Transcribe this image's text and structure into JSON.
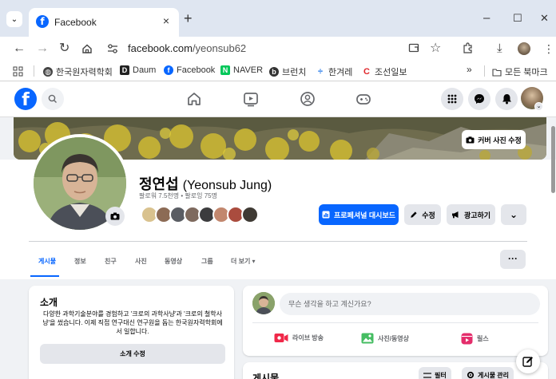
{
  "browser": {
    "tab_title": "Facebook",
    "tab_close": "×",
    "new_tab": "+",
    "window": {
      "minimize": "–",
      "maximize": "☐",
      "close": "✕"
    },
    "url_host": "facebook.com",
    "url_path": "/yeonsub62",
    "bookmarks": [
      {
        "label": "한국원자력학회",
        "icon": "globe-icon"
      },
      {
        "label": "Daum",
        "icon": "daum-icon"
      },
      {
        "label": "Facebook",
        "icon": "facebook-icon"
      },
      {
        "label": "NAVER",
        "icon": "naver-icon"
      },
      {
        "label": "브런치",
        "icon": "brunch-icon"
      },
      {
        "label": "한겨레",
        "icon": "hani-icon"
      },
      {
        "label": "조선일보",
        "icon": "chosun-icon"
      }
    ],
    "bookmarks_overflow": "»",
    "bookmarks_all": "모든 북마크"
  },
  "profile": {
    "name_ko": "정연섭",
    "name_en": "(Yeonsub Jung)",
    "followers": "팔로워 7.5천명 • 팔로잉 75명",
    "cover_edit_label": "커버 사진 수정",
    "dashboard_label": "프로페셔널 대시보드",
    "edit_label": "수정",
    "advertise_label": "광고하기",
    "tabs": [
      "게시물",
      "정보",
      "친구",
      "사진",
      "동영상",
      "그룹",
      "더 보기 ▾"
    ],
    "more_label": "···"
  },
  "intro": {
    "title": "소개",
    "bio": "다양한 과학기술분야를 경험하고 '크로의 과학사냥'과 '크로의 철학사냥'을 썼습니다. 이제 직접 연구대신 연구원을 돕는 한국원자력학회에서 일합니다.",
    "edit_label": "소개 수정"
  },
  "composer": {
    "placeholder": "무슨 생각을 하고 계신가요?",
    "live_label": "라이브 방송",
    "photo_label": "사진/동영상",
    "reels_label": "릴스"
  },
  "posts": {
    "title": "게시물",
    "filter_label": "필터",
    "manage_label": "게시물 관리"
  },
  "colors": {
    "fb_blue": "#0866ff",
    "page_bg": "#f0f2f5",
    "button_gray": "#e4e6eb"
  }
}
